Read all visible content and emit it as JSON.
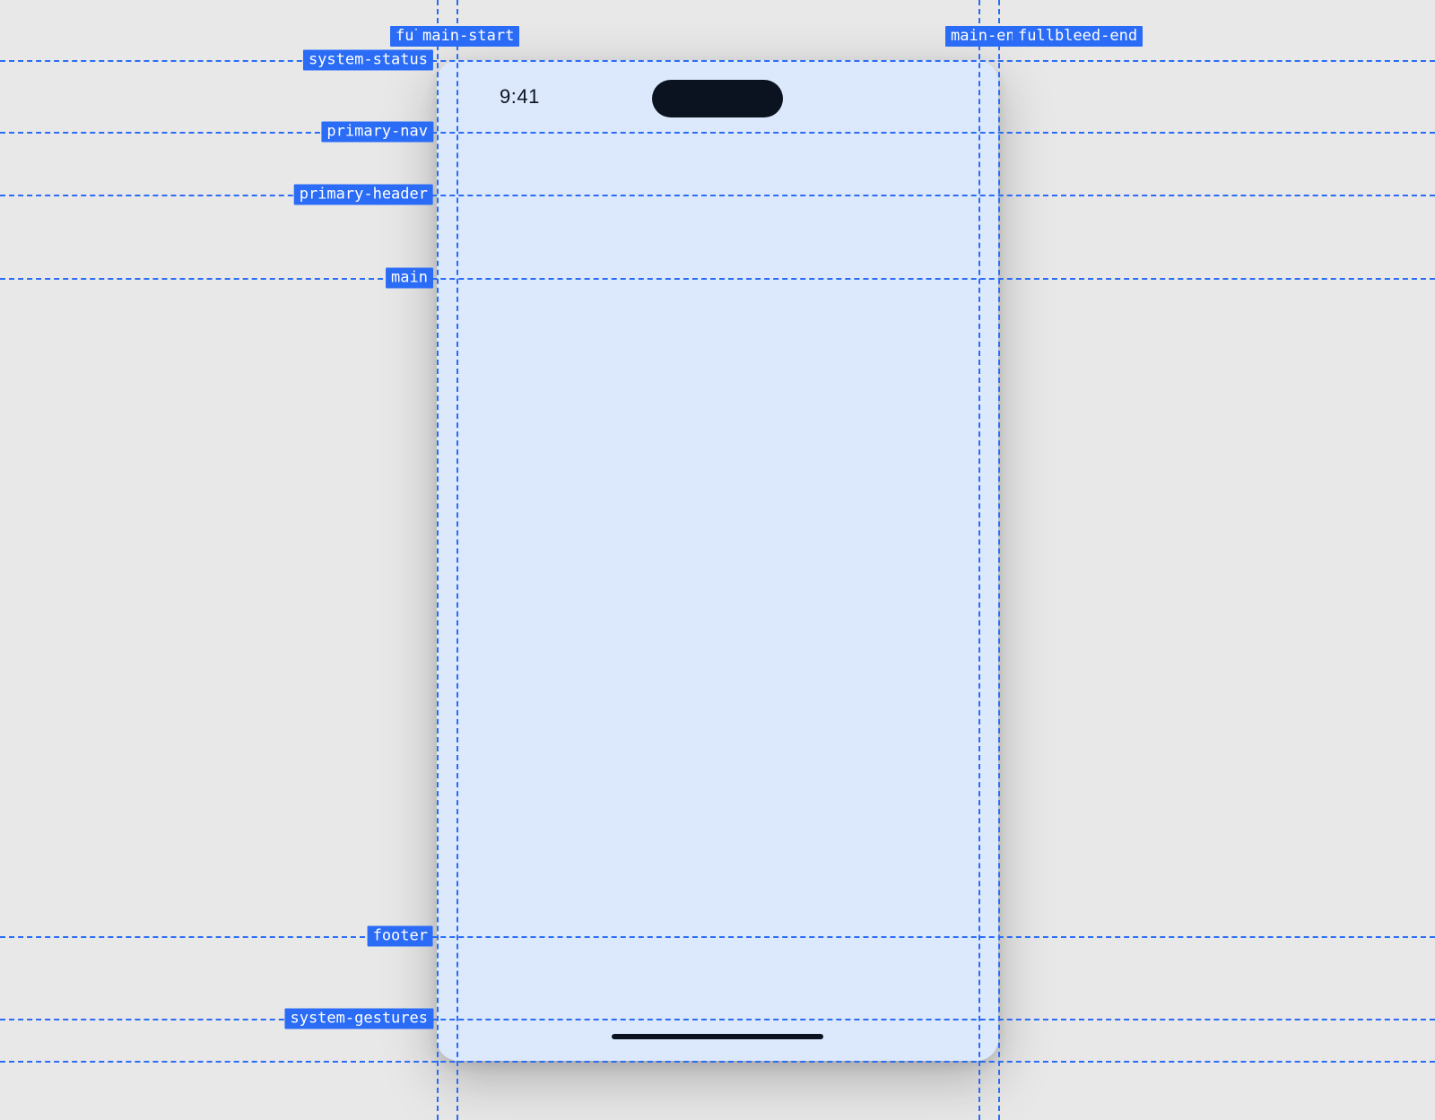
{
  "statusBar": {
    "time": "9:41"
  },
  "guides": {
    "vertical": {
      "fullbleed": "fullbleed",
      "mainStart": "main-start",
      "mainEnd": "main-end",
      "fullbleedEnd": "fullbleed-end"
    },
    "horizontal": {
      "systemStatus": "system-status",
      "primaryNav": "primary-nav",
      "primaryHeader": "primary-header",
      "main": "main",
      "footer": "footer",
      "systemGestures": "system-gestures"
    }
  }
}
